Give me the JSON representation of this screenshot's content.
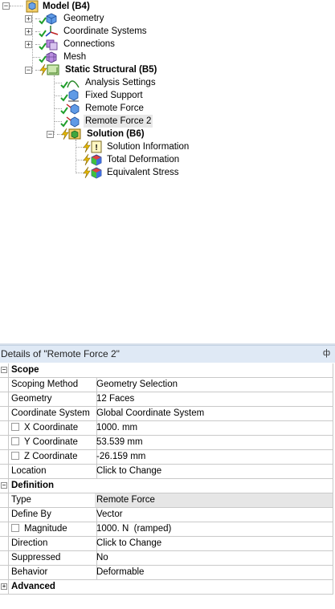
{
  "tree": {
    "model": "Model (B4)",
    "geometry": "Geometry",
    "coordinate_systems": "Coordinate Systems",
    "connections": "Connections",
    "mesh": "Mesh",
    "static_structural": "Static Structural (B5)",
    "analysis_settings": "Analysis Settings",
    "fixed_support": "Fixed Support",
    "remote_force": "Remote Force",
    "remote_force_2": "Remote Force 2",
    "solution": "Solution (B6)",
    "solution_information": "Solution Information",
    "total_deformation": "Total Deformation",
    "equivalent_stress": "Equivalent Stress"
  },
  "details": {
    "title": "Details of \"Remote Force 2\"",
    "pin": "ф",
    "scope": {
      "label": "Scope",
      "scoping_method_key": "Scoping Method",
      "scoping_method_val": "Geometry Selection",
      "geometry_key": "Geometry",
      "geometry_val": "12 Faces",
      "coord_system_key": "Coordinate System",
      "coord_system_val": "Global Coordinate System",
      "x_key": "X Coordinate",
      "x_val": "1000. mm",
      "y_key": "Y Coordinate",
      "y_val": "53.539 mm",
      "z_key": "Z Coordinate",
      "z_val": "-26.159 mm",
      "location_key": "Location",
      "location_val": "Click to Change"
    },
    "definition": {
      "label": "Definition",
      "type_key": "Type",
      "type_val": "Remote Force",
      "define_by_key": "Define By",
      "define_by_val": "Vector",
      "magnitude_key": "Magnitude",
      "magnitude_val": "1000. N  (ramped)",
      "direction_key": "Direction",
      "direction_val": "Click to Change",
      "suppressed_key": "Suppressed",
      "suppressed_val": "No",
      "behavior_key": "Behavior",
      "behavior_val": "Deformable"
    },
    "advanced": {
      "label": "Advanced"
    }
  },
  "colors": {
    "check": "#1f9e2a",
    "bolt": "#e5b800",
    "header_bg": "#dfe9f5",
    "selected_value_bg": "#e6e6e6"
  },
  "icons": [
    "model-icon",
    "geometry-icon",
    "coordinate-systems-icon",
    "connections-icon",
    "mesh-icon",
    "static-structural-icon",
    "analysis-settings-icon",
    "fixed-support-icon",
    "remote-force-icon",
    "solution-icon",
    "solution-information-icon",
    "total-deformation-icon",
    "equivalent-stress-icon",
    "pin-icon"
  ]
}
